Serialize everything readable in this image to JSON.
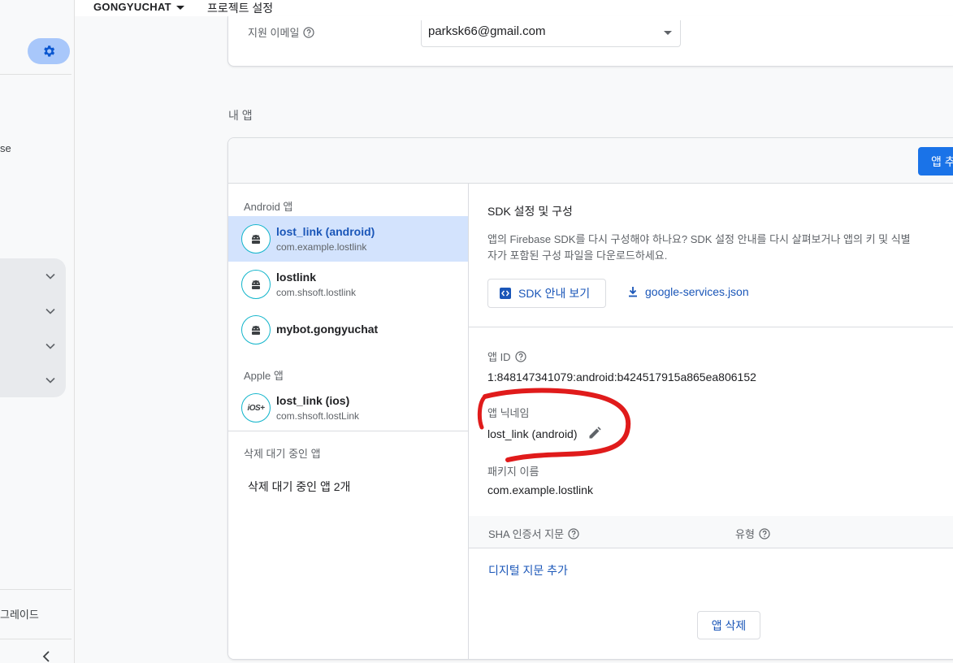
{
  "topbar": {
    "project_name": "GONGYUCHAT",
    "crumb": "프로젝트 설정"
  },
  "leftnav": {
    "truncated_label": "se",
    "upgrade_label": "그레이드"
  },
  "support_email": {
    "label": "지원 이메일",
    "value": "parksk66@gmail.com"
  },
  "my_apps": {
    "title": "내 앱",
    "add_app_label": "앱 추"
  },
  "app_list": {
    "android_section": "Android 앱",
    "apple_section": "Apple 앱",
    "pending_section": "삭제 대기 중인 앱",
    "pending_text": "삭제 대기 중인 앱 2개",
    "android_apps": [
      {
        "name": "lost_link (android)",
        "package": "com.example.lostlink"
      },
      {
        "name": "lostlink",
        "package": "com.shsoft.lostlink"
      },
      {
        "name": "mybot.gongyuchat",
        "package": ""
      }
    ],
    "apple_apps": [
      {
        "name": "lost_link (ios)",
        "package": "com.shsoft.lostLink",
        "icon_text": "iOS+"
      }
    ]
  },
  "detail": {
    "sdk_title": "SDK 설정 및 구성",
    "sdk_desc_line1": "앱의 Firebase SDK를 다시 구성해야 하나요? SDK 설정 안내를 다시 살펴보거나 앱의 키 및 식별",
    "sdk_desc_line2": "자가 포함된 구성 파일을 다운로드하세요.",
    "sdk_button": "SDK 안내 보기",
    "download_link": "google-services.json",
    "app_id_label": "앱 ID",
    "app_id_value": "1:848147341079:android:b424517915a865ea806152",
    "nickname_label": "앱 닉네임",
    "nickname_value": "lost_link (android)",
    "package_label": "패키지 이름",
    "package_value": "com.example.lostlink",
    "sha_col": "SHA 인증서 지문",
    "type_col": "유형",
    "add_fingerprint": "디지털 지문 추가",
    "delete_button": "앱 삭제"
  },
  "colors": {
    "accent": "#1a73e8",
    "link": "#1a56b8",
    "selected_bg": "#d3e3fd",
    "annotation": "#e01b1b"
  }
}
